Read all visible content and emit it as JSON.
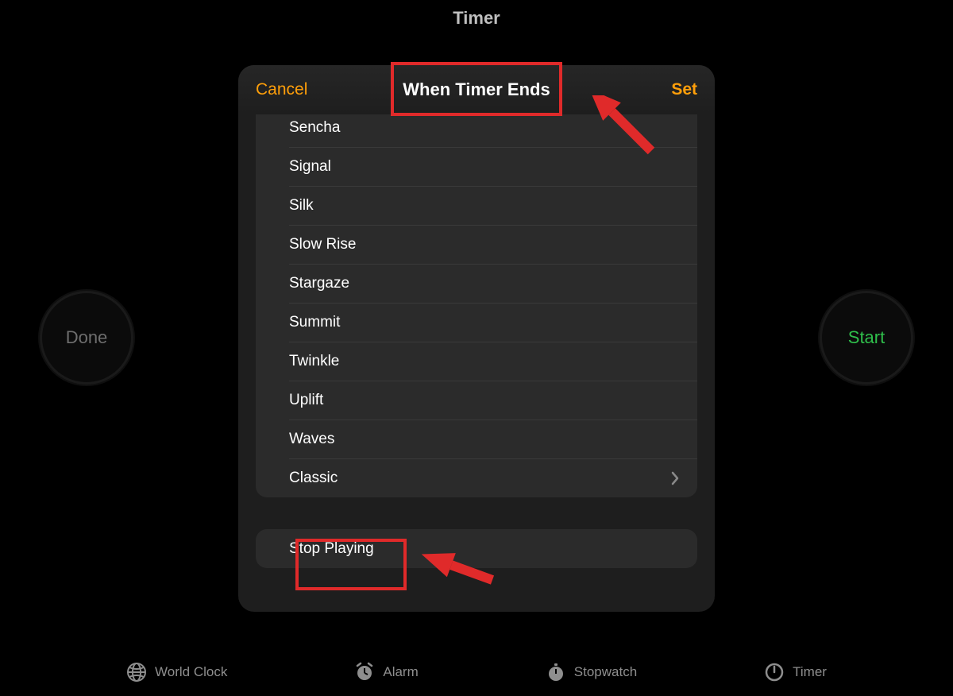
{
  "page_title": "Timer",
  "buttons": {
    "done": "Done",
    "start": "Start"
  },
  "sheet": {
    "cancel": "Cancel",
    "set": "Set",
    "title": "When Timer Ends",
    "rows": [
      {
        "label": "Sencha"
      },
      {
        "label": "Signal"
      },
      {
        "label": "Silk"
      },
      {
        "label": "Slow Rise"
      },
      {
        "label": "Stargaze"
      },
      {
        "label": "Summit"
      },
      {
        "label": "Twinkle"
      },
      {
        "label": "Uplift"
      },
      {
        "label": "Waves"
      },
      {
        "label": "Classic",
        "disclosure": true
      }
    ],
    "stop_playing": "Stop Playing"
  },
  "tabs": {
    "world_clock": "World Clock",
    "alarm": "Alarm",
    "stopwatch": "Stopwatch",
    "timer": "Timer"
  },
  "colors": {
    "accent_orange": "#ff9f0a",
    "accent_green": "#2fbf4b",
    "annotation_red": "#e02a2a"
  }
}
